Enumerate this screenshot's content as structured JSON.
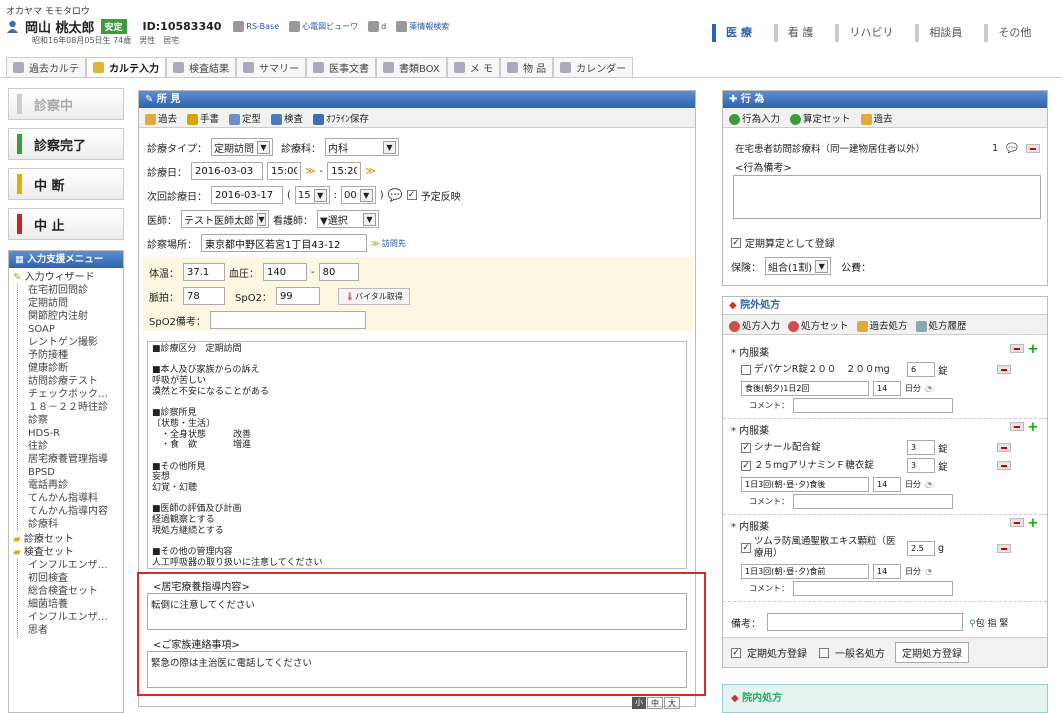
{
  "patient": {
    "kana": "オカヤマ モモタロウ",
    "name": "岡山 桃太郎",
    "badge": "安定",
    "id": "ID:10583340",
    "birth": "昭和16年08月05日生 74歳",
    "sex": "男性",
    "home": "居宅",
    "links": [
      "RS-Base",
      "心電図ビューワ",
      "d",
      "薬情報検索"
    ]
  },
  "role_tabs": [
    "医 療",
    "看 護",
    "リハビリ",
    "相談員",
    "その他"
  ],
  "main_tabs": [
    "過去カルテ",
    "カルテ入力",
    "検査結果",
    "サマリー",
    "医事文書",
    "書類BOX",
    "メ モ",
    "物 品",
    "カレンダー"
  ],
  "status": {
    "in_exam": "診察中",
    "done": "診察完了",
    "interrupt": "中 断",
    "cancel": "中 止"
  },
  "menu": {
    "title": "入力支援メニュー",
    "wizard": "入力ウィザード",
    "items": [
      "在宅初回問診",
      "定期訪問",
      "関節腔内注射",
      "SOAP",
      "レントゲン撮影",
      "予防接種",
      "健康診断",
      "訪問診療テスト",
      "チェックボック…",
      "１８－２２時往診",
      "診察",
      "HDS-R",
      "往診",
      "居宅療養管理指導",
      "BPSD",
      "電話再診",
      "てんかん指導料",
      "てんかん指導内容",
      "診療科"
    ],
    "set1": "診療セット",
    "set2": "検査セット",
    "set2_items": [
      "インフルエンザ…",
      "初回検査",
      "総合検査セット",
      "細菌培養",
      "インフルエンザ…",
      "思者"
    ]
  },
  "shoken": {
    "title": "所 見",
    "tools": [
      "過去",
      "手書",
      "定型",
      "検査",
      "ｵﾌﾗｲﾝ保存"
    ],
    "type_label": "診療タイプ：",
    "type_val": "定期訪問",
    "dept_label": "診療科：",
    "dept_val": "内科",
    "date_label": "診療日：",
    "date_val": "2016-03-03",
    "from": "15:00",
    "to": "15:20",
    "next_label": "次回診療日：",
    "next_val": "2016-03-17",
    "next_h": "15",
    "next_m": "00",
    "reflect": "予定反映",
    "doc_label": "医師：",
    "doc_val": "テスト医師太郎",
    "nurse_label": "看護師：",
    "nurse_val": "▼選択",
    "place_label": "診察場所：",
    "place_val": "東京都中野区若宮1丁目43-12",
    "visit": "訪問先",
    "temp_label": "体温：",
    "temp": "37.1",
    "bp_label": "血圧：",
    "bp1": "140",
    "bp2": "80",
    "pulse_label": "脈拍：",
    "pulse": "78",
    "spo2_label": "SpO2：",
    "spo2": "99",
    "vital_btn": "バイタル取得",
    "spo2note_label": "SpO2備考：",
    "notes": [
      "■診療区分　定期訪問",
      "",
      "■本人及び家族からの訴え",
      "呼吸が苦しい",
      "漠然と不安になることがある",
      "",
      "■診察所見",
      "〔状態・生活〕",
      "　・全身状態　　　改善",
      "　・食　欲　　　　増進",
      "",
      "■その他所見",
      "妄想",
      "幻覚・幻聴",
      "",
      "■医師の評価及び計画",
      "経過観察とする",
      "現処方継続とする",
      "",
      "■その他の管理内容",
      "人工呼吸器の取り扱いに注意してください"
    ],
    "home_label": "<居宅療養指導内容>",
    "home_text": "転倒に注意してください",
    "family_label": "<ご家族連絡事項>",
    "family_text": "緊急の際は主治医に電話してください",
    "sizes": [
      "小",
      "中",
      "大"
    ]
  },
  "koui": {
    "title": "行 為",
    "tools": [
      "行為入力",
      "算定セット",
      "過去"
    ],
    "item": "在宅患者訪問診療料（同一建物居住者以外）",
    "count": "1",
    "memo": "<行為備考>",
    "periodic": "定期算定として登録",
    "ins_label": "保険：",
    "ins_val": "組合(1割)",
    "pub": "公費："
  },
  "rx": {
    "title": "院外処方",
    "tools": [
      "処方入力",
      "処方セット",
      "過去処方",
      "処方履歴"
    ],
    "groups": [
      {
        "type": "* 内服薬",
        "drugs": [
          {
            "name": "デパケンR錠２００　２００mg",
            "qty": "6",
            "unit": "錠",
            "checked": false
          }
        ],
        "usage": "食後(朝夕)1日2回",
        "days": "14",
        "day_unit": "日分"
      },
      {
        "type": "* 内服薬",
        "drugs": [
          {
            "name": "シナール配合錠",
            "qty": "3",
            "unit": "錠",
            "checked": true
          },
          {
            "name": "２５mgアリナミンＦ糖衣錠",
            "qty": "3",
            "unit": "錠",
            "checked": true
          }
        ],
        "usage": "1日3回(朝･昼･夕)食後",
        "days": "14",
        "day_unit": "日分"
      },
      {
        "type": "* 内服薬",
        "drugs": [
          {
            "name": "ツムラ防風通聖散エキス顆粒（医療用）",
            "qty": "2.5",
            "unit": "g",
            "checked": true
          }
        ],
        "usage": "1日3回(朝･昼･夕)食前",
        "days": "14",
        "day_unit": "日分"
      }
    ],
    "comment_label": "コメント：",
    "note_label": "備考：",
    "pack": "包 指 緊",
    "periodic": "定期処方登録",
    "generic": "一般名処方",
    "reg_btn": "定期処方登録"
  },
  "innai": {
    "title": "院内処方"
  }
}
